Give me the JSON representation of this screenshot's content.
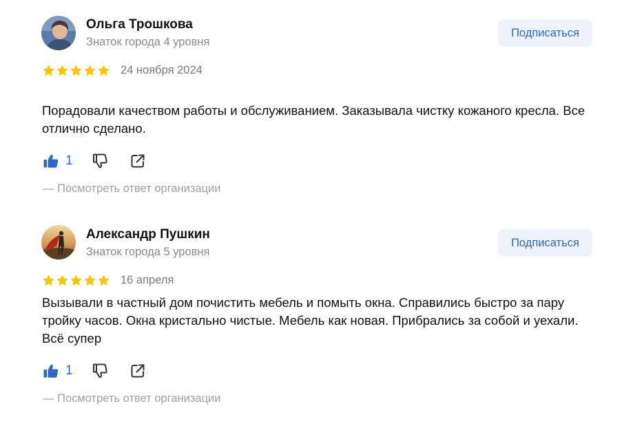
{
  "reviews": [
    {
      "author": "Ольга Трошкова",
      "level": "Знаток города 4 уровня",
      "subscribe_label": "Подписаться",
      "rating": 5,
      "date": "24 ноября 2024",
      "text": "Порадовали качеством работы и обслуживанием. Заказывала чистку кожаного кресла. Все отлично сделано.",
      "likes": "1",
      "response_link": "— Посмотреть ответ организации"
    },
    {
      "author": "Александр Пушкин",
      "level": "Знаток города 5 уровня",
      "subscribe_label": "Подписаться",
      "rating": 5,
      "date": "16 апреля",
      "text": "Вызывали в частный дом почистить мебель и помыть окна. Справились быстро за пару тройку часов. Окна кристально чистые. Мебель как новая. Прибрались за собой и уехали. Всё супер",
      "likes": "1",
      "response_link": "— Посмотреть ответ организации"
    }
  ],
  "colors": {
    "accent": "#2d68c8",
    "star": "#fcc300",
    "muted": "#8a8a8a",
    "subscribe_bg": "#eef3fb"
  },
  "icons": [
    "thumb-up-icon",
    "thumb-down-icon",
    "share-icon",
    "star-icon"
  ]
}
